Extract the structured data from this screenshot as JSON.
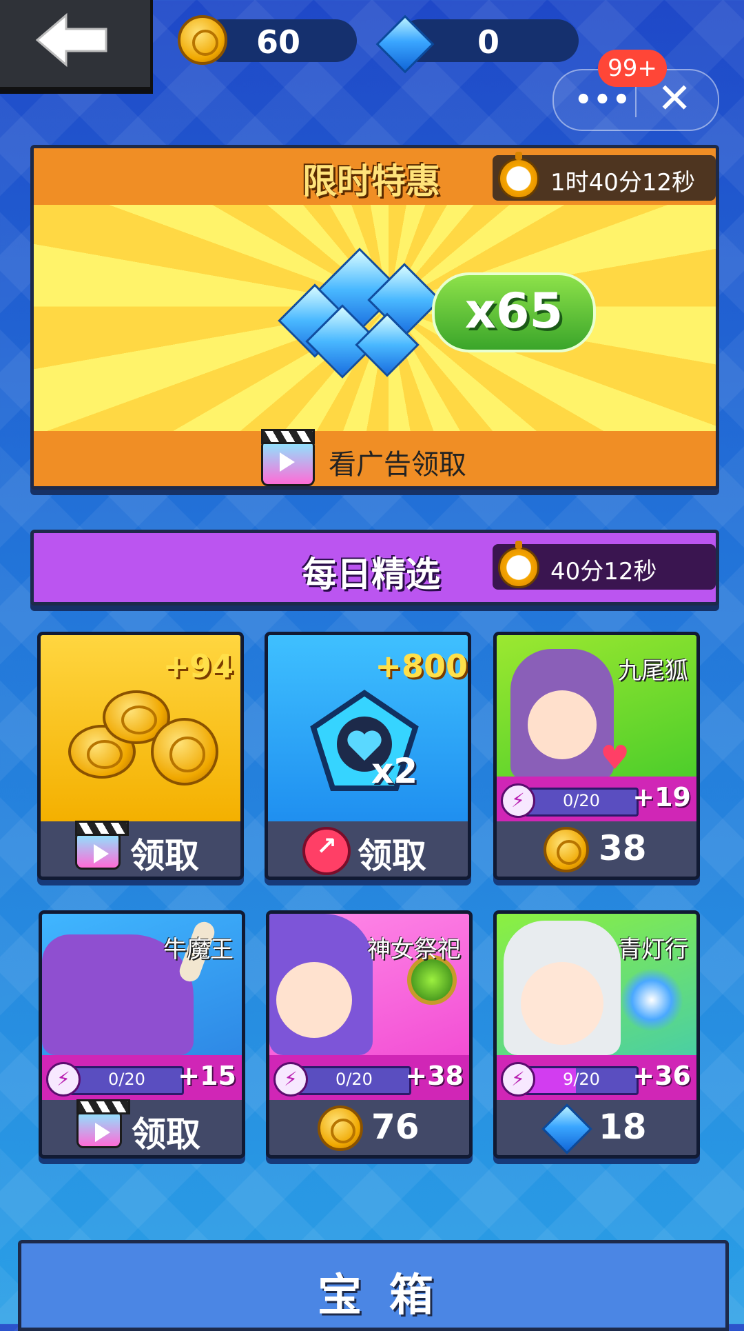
{
  "topbar": {
    "coins": "60",
    "gems": "0",
    "badge": "99+",
    "more_label": "•••",
    "close_label": "✕"
  },
  "offer": {
    "title": "限时特惠",
    "timer": "1时40分12秒",
    "amount": "x65",
    "claim_label": "看广告领取"
  },
  "daily": {
    "title": "每日精选",
    "timer": "40分12秒"
  },
  "cards": [
    {
      "corner": "+94",
      "action": "领取"
    },
    {
      "corner": "+800",
      "action": "领取",
      "multiplier": "x2"
    },
    {
      "name": "九尾狐",
      "progress": "0/20",
      "progress_value": 0,
      "plus": "+19",
      "price": "38"
    },
    {
      "name": "牛魔王",
      "progress": "0/20",
      "progress_value": 0,
      "plus": "+15",
      "action": "领取"
    },
    {
      "name": "神女祭祀",
      "progress": "0/20",
      "progress_value": 0,
      "plus": "+38",
      "price": "76"
    },
    {
      "name": "青灯行",
      "progress": "9/20",
      "progress_value": 0.45,
      "plus": "+36",
      "price": "18"
    }
  ],
  "treasure": {
    "title": "宝箱"
  },
  "colors": {
    "accent_orange": "#f08e25",
    "accent_purple": "#bb55f0",
    "progress_pink": "#d026b6"
  }
}
